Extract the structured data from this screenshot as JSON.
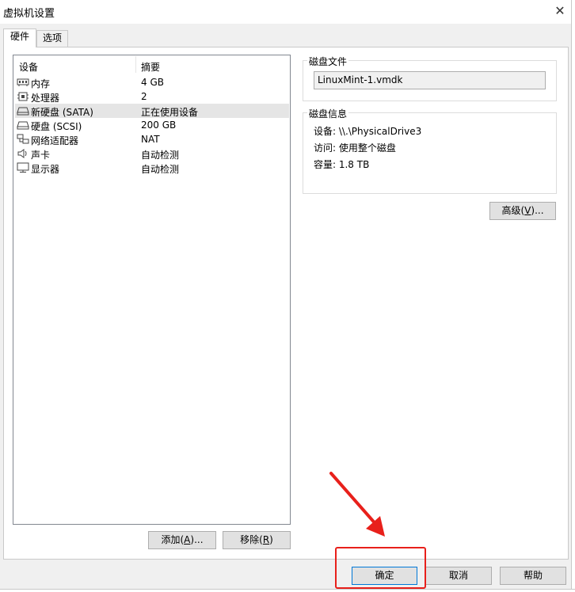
{
  "window": {
    "title": "虚拟机设置",
    "close": "✕"
  },
  "tabs": [
    {
      "label": "硬件"
    },
    {
      "label": "选项"
    }
  ],
  "device_list": {
    "columns": {
      "device": "设备",
      "summary": "摘要"
    },
    "rows": [
      {
        "icon": "memory-icon",
        "name": "内存",
        "summary": "4 GB"
      },
      {
        "icon": "processor-icon",
        "name": "处理器",
        "summary": "2"
      },
      {
        "icon": "hard-disk-icon",
        "name": "新硬盘 (SATA)",
        "summary": "正在使用设备",
        "selected": true
      },
      {
        "icon": "hard-disk-icon",
        "name": "硬盘 (SCSI)",
        "summary": "200 GB"
      },
      {
        "icon": "network-adapter-icon",
        "name": "网络适配器",
        "summary": "NAT"
      },
      {
        "icon": "speaker-icon",
        "name": "声卡",
        "summary": "自动检测"
      },
      {
        "icon": "monitor-icon",
        "name": "显示器",
        "summary": "自动检测"
      }
    ]
  },
  "buttons": {
    "add": {
      "text": "添加(",
      "key": "A",
      "tail": ")..."
    },
    "remove": {
      "text": "移除(",
      "key": "R",
      "tail": ")"
    },
    "advanced": {
      "text": "高级(",
      "key": "V",
      "tail": ")..."
    },
    "ok": "确定",
    "cancel": "取消",
    "help": "帮助"
  },
  "disk_file": {
    "label": "磁盘文件",
    "value": "LinuxMint-1.vmdk"
  },
  "disk_info": {
    "label": "磁盘信息",
    "device": "设备: \\\\.\\PhysicalDrive3",
    "access": "访问: 使用整个磁盘",
    "capacity": "容量: 1.8 TB"
  },
  "annotation": {
    "color": "#e8201b"
  }
}
